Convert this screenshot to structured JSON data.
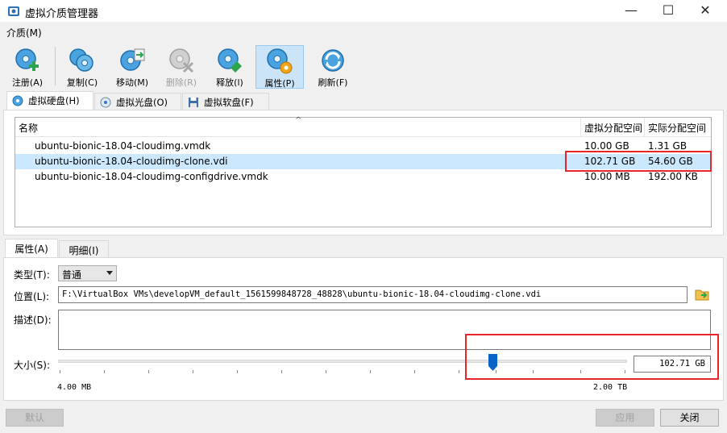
{
  "window": {
    "title": "虚拟介质管理器",
    "min_glyph": "—",
    "max_glyph": "☐",
    "close_glyph": "✕"
  },
  "menu": {
    "media": "介质(M)"
  },
  "toolbar": {
    "items": [
      {
        "label": "注册(A)",
        "icon": "register-disk-icon",
        "enabled": true
      },
      {
        "label": "复制(C)",
        "icon": "copy-disk-icon",
        "enabled": true
      },
      {
        "label": "移动(M)",
        "icon": "move-disk-icon",
        "enabled": true
      },
      {
        "label": "删除(R)",
        "icon": "remove-disk-icon",
        "enabled": false
      },
      {
        "label": "释放(l)",
        "icon": "release-disk-icon",
        "enabled": true
      },
      {
        "label": "属性(P)",
        "icon": "properties-disk-icon",
        "enabled": true,
        "active": true
      },
      {
        "label": "刷新(F)",
        "icon": "refresh-icon",
        "enabled": true
      }
    ]
  },
  "media_tabs": [
    {
      "label": "虚拟硬盘(H)",
      "selected": true
    },
    {
      "label": "虚拟光盘(O)",
      "selected": false
    },
    {
      "label": "虚拟软盘(F)",
      "selected": false
    }
  ],
  "table": {
    "columns": [
      "名称",
      "虚拟分配空间",
      "实际分配空间"
    ],
    "sort_glyph": "^",
    "rows": [
      {
        "name": "ubuntu-bionic-18.04-cloudimg.vmdk",
        "virtual": "10.00 GB",
        "actual": "1.31 GB",
        "selected": false
      },
      {
        "name": "ubuntu-bionic-18.04-cloudimg-clone.vdi",
        "virtual": "102.71 GB",
        "actual": "54.60 GB",
        "selected": true
      },
      {
        "name": "ubuntu-bionic-18.04-cloudimg-configdrive.vmdk",
        "virtual": "10.00 MB",
        "actual": "192.00 KB",
        "selected": false
      }
    ]
  },
  "props_tabs": [
    {
      "label": "属性(A)",
      "selected": true
    },
    {
      "label": "明细(I)",
      "selected": false
    }
  ],
  "props": {
    "type_label": "类型(T):",
    "type_value": "普通",
    "location_label": "位置(L):",
    "location_value": "F:\\VirtualBox VMs\\developVM_default_1561599848728_48828\\ubuntu-bionic-18.04-cloudimg-clone.vdi",
    "desc_label": "描述(D):",
    "desc_value": "",
    "size_label": "大小(S):",
    "size_min": "4.00 MB",
    "size_max": "2.00 TB",
    "size_value": "102.71 GB"
  },
  "buttons": {
    "reset": "默认",
    "apply": "应用",
    "close": "关闭"
  },
  "colors": {
    "highlight_box": "#e8262a",
    "selection": "#cce8ff",
    "accent": "#1e7ad8"
  }
}
